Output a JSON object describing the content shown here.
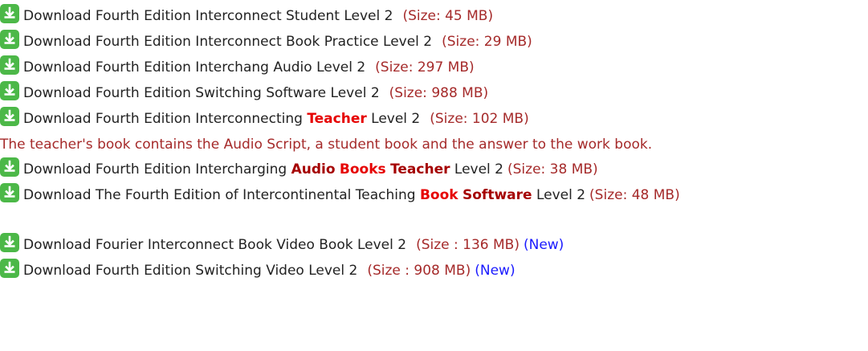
{
  "downloads": [
    {
      "parts": [
        {
          "text": "Download Fourth Edition Interconnect Student Level 2",
          "style": "plain"
        }
      ],
      "size": "(Size: 45 MB)"
    },
    {
      "parts": [
        {
          "text": "Download Fourth Edition Interconnect Book Practice Level 2",
          "style": "plain"
        }
      ],
      "size": "(Size: 29 MB)"
    },
    {
      "parts": [
        {
          "text": "Download Fourth Edition Interchang Audio Level 2",
          "style": "plain"
        }
      ],
      "size": "(Size: 297 MB)"
    },
    {
      "parts": [
        {
          "text": "Download Fourth Edition Switching Software Level 2",
          "style": "plain"
        }
      ],
      "size": "(Size: 988 MB)"
    },
    {
      "parts": [
        {
          "text": "Download Fourth Edition Interconnecting ",
          "style": "plain"
        },
        {
          "text": "Teacher",
          "style": "red"
        },
        {
          "text": " Level 2",
          "style": "plain"
        }
      ],
      "size": "(Size: 102 MB)"
    }
  ],
  "note": "The teacher's book contains the Audio Script, a student book and the answer to the work book.",
  "downloads2": [
    {
      "parts": [
        {
          "text": "Download Fourth Edition Intercharging ",
          "style": "plain"
        },
        {
          "text": "Audio",
          "style": "dark"
        },
        {
          "text": " ",
          "style": "plain"
        },
        {
          "text": "Books",
          "style": "red"
        },
        {
          "text": " ",
          "style": "plain"
        },
        {
          "text": "Teacher",
          "style": "dark"
        },
        {
          "text": " Level 2",
          "style": "plain"
        }
      ],
      "size": "(Size: 38 MB)"
    },
    {
      "parts": [
        {
          "text": "Download The Fourth Edition of Intercontinental Teaching ",
          "style": "plain"
        },
        {
          "text": "Book",
          "style": "red"
        },
        {
          "text": " ",
          "style": "plain"
        },
        {
          "text": "Software",
          "style": "dark"
        },
        {
          "text": " Level 2",
          "style": "plain"
        }
      ],
      "size": "(Size: 48 MB)"
    }
  ],
  "downloads3": [
    {
      "parts": [
        {
          "text": "Download Fourier Interconnect Book Video Book Level 2",
          "style": "plain"
        }
      ],
      "size": "(Size : 136 MB)",
      "new": "(New)"
    },
    {
      "parts": [
        {
          "text": "Download Fourth Edition Switching Video Level 2",
          "style": "plain"
        }
      ],
      "size": "(Size : 908 MB)",
      "new": "(New)"
    }
  ],
  "colors": {
    "icon": "#4cb848",
    "size_text": "#a52a2a",
    "highlight_red": "#e60000",
    "highlight_dark": "#a50000",
    "new_link": "#1a1aff"
  },
  "icons": {
    "download": "download-arrow-icon"
  }
}
